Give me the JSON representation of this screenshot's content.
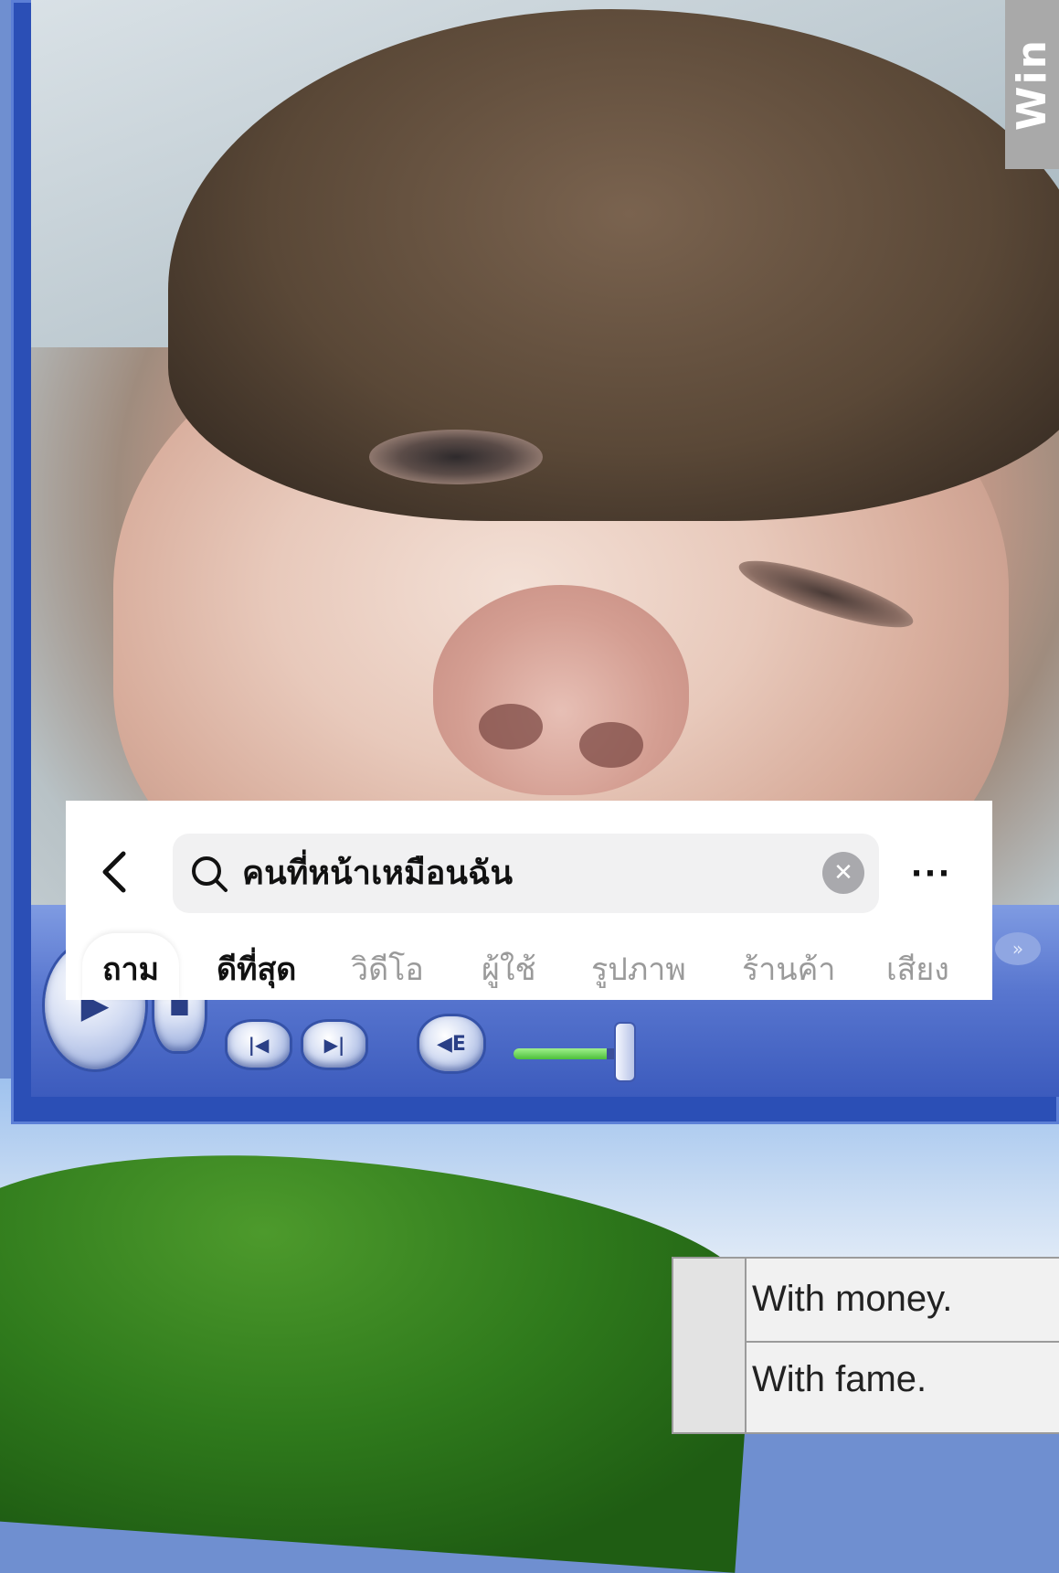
{
  "background": {
    "window_label": "Win",
    "xp_menu": {
      "items": [
        "With money.",
        "With fame."
      ]
    }
  },
  "player": {
    "controls": {
      "play_glyph": "▶",
      "stop_glyph": "■",
      "prev_glyph": "|◀",
      "next_glyph": "▶|",
      "mute_glyph": "◀E",
      "extra_glyph": "»",
      "volume_level": 0.85
    }
  },
  "search": {
    "back_glyph": "‹",
    "query": "คนที่หน้าเหมือนฉัน",
    "clear_glyph": "✕",
    "more_glyph": "···",
    "tabs": [
      {
        "label": "ถาม",
        "state": "selected"
      },
      {
        "label": "ดีที่สุด",
        "state": "bold"
      },
      {
        "label": "วิดีโอ",
        "state": "normal"
      },
      {
        "label": "ผู้ใช้",
        "state": "normal"
      },
      {
        "label": "รูปภาพ",
        "state": "normal"
      },
      {
        "label": "ร้านค้า",
        "state": "normal"
      },
      {
        "label": "เสียง",
        "state": "normal"
      }
    ]
  },
  "colors": {
    "player_blue": "#3c5bbd",
    "search_bg": "#f1f1f2",
    "tab_inactive": "#9a9a9a",
    "xp_green": "#2f7a1c"
  }
}
